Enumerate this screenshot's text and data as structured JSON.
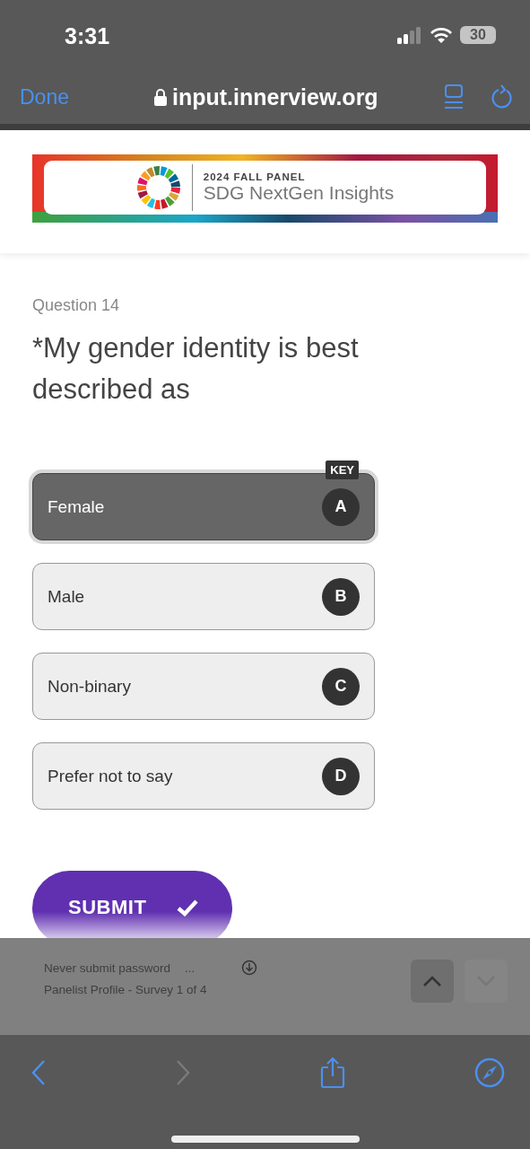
{
  "status_bar": {
    "time": "3:31",
    "battery": "30"
  },
  "browser_bar": {
    "done": "Done",
    "url": "input.innerview.org"
  },
  "banner": {
    "eyebrow": "2024 FALL PANEL",
    "title": "SDG NextGen Insights"
  },
  "question": {
    "number": "Question 14",
    "text": "*My gender identity is best described as"
  },
  "options": [
    {
      "label": "Female",
      "key": "A",
      "badge": "KEY",
      "selected": true
    },
    {
      "label": "Male",
      "key": "B",
      "selected": false
    },
    {
      "label": "Non-binary",
      "key": "C",
      "selected": false
    },
    {
      "label": "Prefer not to say",
      "key": "D",
      "selected": false
    }
  ],
  "submit": {
    "label": "SUBMIT"
  },
  "find_bar": {
    "line_1": "Never submit password",
    "ellipsis": "...",
    "line_2": "Panelist Profile - Survey 1 of 4",
    "previous_disabled": false,
    "next_disabled": true
  },
  "toolbar": {
    "back_disabled": false,
    "forward_disabled": true
  }
}
